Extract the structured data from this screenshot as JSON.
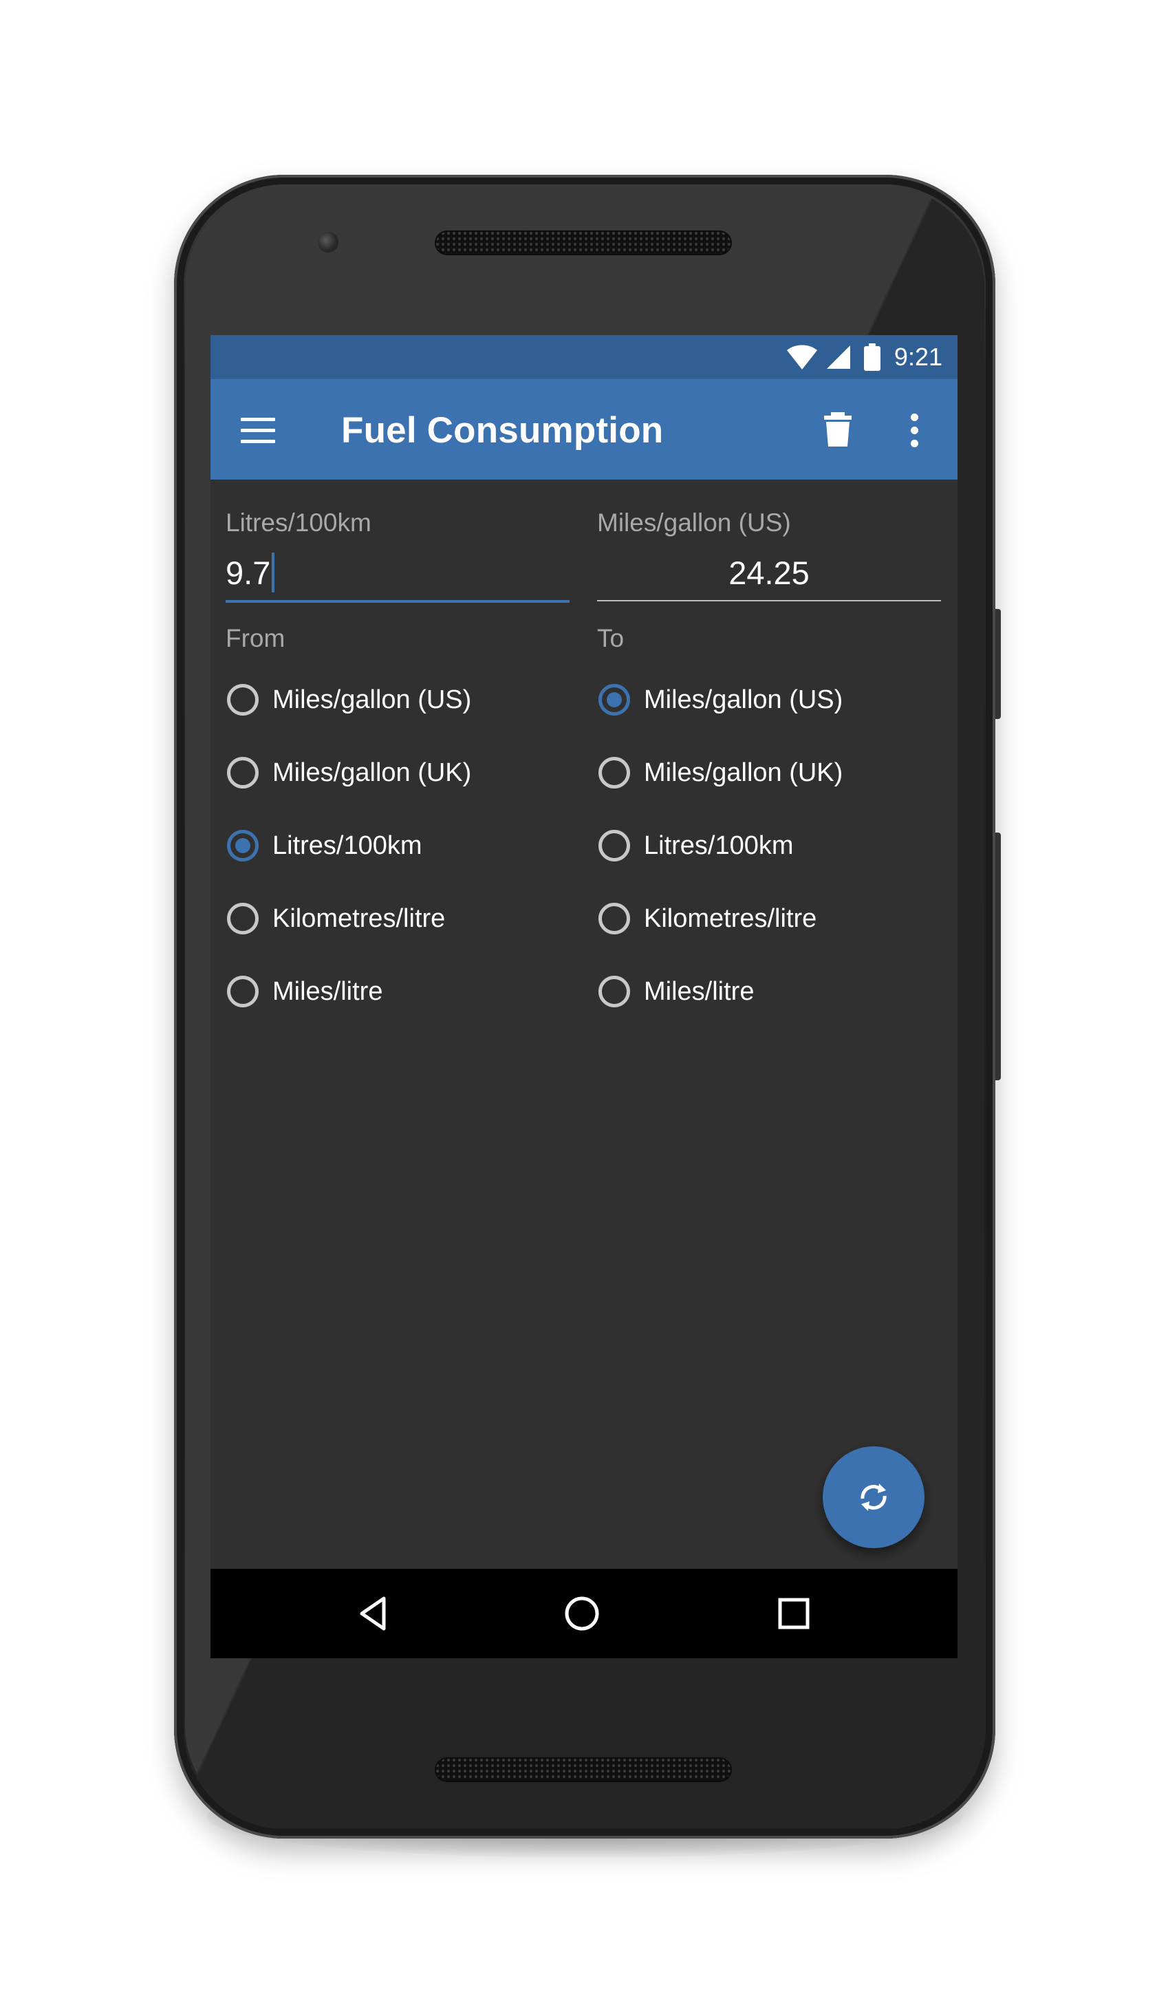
{
  "status_bar": {
    "time": "9:21"
  },
  "app_bar": {
    "title": "Fuel Consumption"
  },
  "input": {
    "from_label": "Litres/100km",
    "from_value": "9.7",
    "to_label": "Miles/gallon (US)",
    "to_value": "24.25"
  },
  "from": {
    "label": "From",
    "selected": "Litres/100km",
    "options": [
      "Miles/gallon (US)",
      "Miles/gallon (UK)",
      "Litres/100km",
      "Kilometres/litre",
      "Miles/litre"
    ]
  },
  "to": {
    "label": "To",
    "selected": "Miles/gallon (US)",
    "options": [
      "Miles/gallon (US)",
      "Miles/gallon (UK)",
      "Litres/100km",
      "Kilometres/litre",
      "Miles/litre"
    ]
  },
  "colors": {
    "primary": "#3d72b0",
    "primary_dark": "#2f5f95",
    "background": "#303030"
  },
  "icons": {
    "menu": "menu-icon",
    "delete": "trash-icon",
    "overflow": "more-vert-icon",
    "fab": "swap-refresh-icon",
    "nav": [
      "back-icon",
      "home-icon",
      "recents-icon"
    ]
  }
}
